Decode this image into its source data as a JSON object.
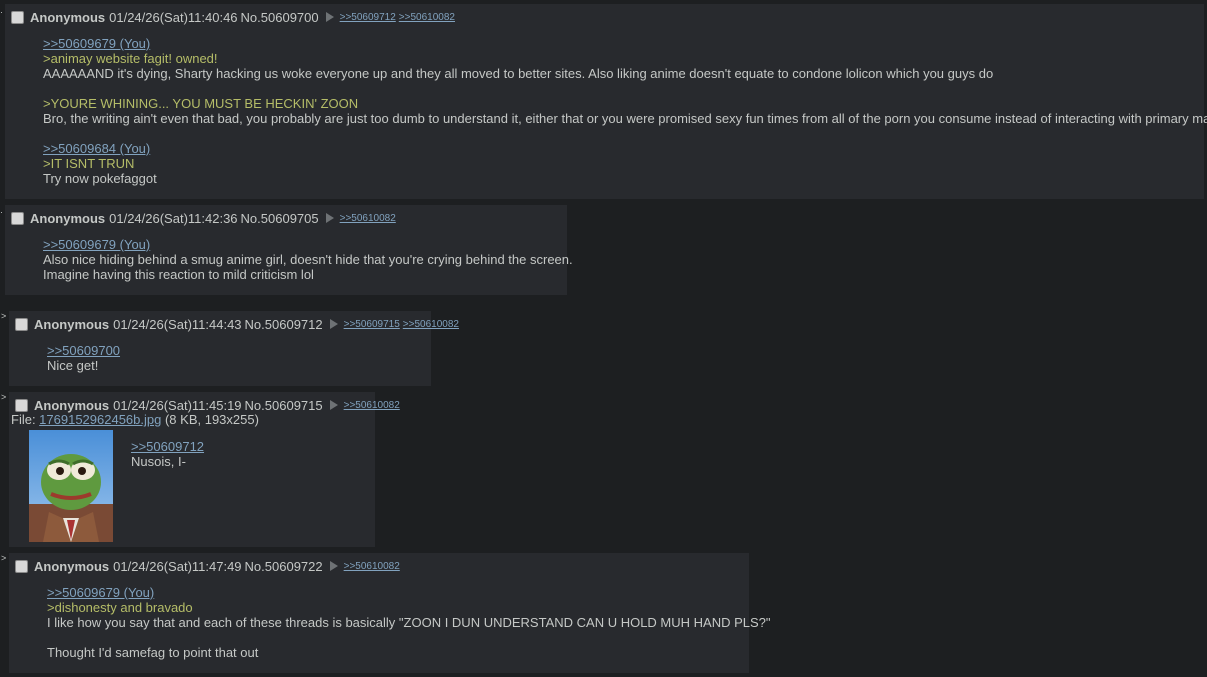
{
  "posts": [
    {
      "name": "Anonymous",
      "datetime": "01/24/26(Sat)11:40:46",
      "number": "No.50609700",
      "backlinks": [
        ">>50609712",
        ">>50610082"
      ],
      "lines": [
        {
          "type": "quote",
          "text": ">>50609679 (You)"
        },
        {
          "type": "green",
          "text": ">animay website fagit! owned!"
        },
        {
          "type": "text",
          "text": "AAAAAAND it's dying, Sharty hacking us woke everyone up and they all moved to better sites. Also liking anime doesn't equate to condone lolicon which you guys do"
        },
        {
          "type": "blank",
          "text": ""
        },
        {
          "type": "green",
          "text": ">YOURE WHINING... YOU MUST BE HECKIN' ZOON"
        },
        {
          "type": "text",
          "text": "Bro, the writing ain't even that bad, you probably are just too dumb to understand it, either that or you were promised sexy fun times from all of the porn you consume instead of interacting with primary materials lol."
        },
        {
          "type": "blank",
          "text": ""
        },
        {
          "type": "quote",
          "text": ">>50609684 (You)"
        },
        {
          "type": "green",
          "text": ">IT ISNT TRUN"
        },
        {
          "type": "text",
          "text": "Try now pokefaggot"
        }
      ]
    },
    {
      "name": "Anonymous",
      "datetime": "01/24/26(Sat)11:42:36",
      "number": "No.50609705",
      "backlinks": [
        ">>50610082"
      ],
      "lines": [
        {
          "type": "quote",
          "text": ">>50609679 (You)"
        },
        {
          "type": "text",
          "text": "Also nice hiding behind a smug anime girl, doesn't hide that you're crying behind the screen."
        },
        {
          "type": "text",
          "text": "Imagine having this reaction to mild criticism lol"
        }
      ]
    },
    {
      "name": "Anonymous",
      "datetime": "01/24/26(Sat)11:44:43",
      "number": "No.50609712",
      "backlinks": [
        ">>50609715",
        ">>50610082"
      ],
      "lines": [
        {
          "type": "quote",
          "text": ">>50609700"
        },
        {
          "type": "text",
          "text": "Nice get!"
        }
      ]
    },
    {
      "name": "Anonymous",
      "datetime": "01/24/26(Sat)11:45:19",
      "number": "No.50609715",
      "backlinks": [
        ">>50610082"
      ],
      "file": {
        "label": "File: ",
        "filename": "1769152962456b.jpg",
        "info": " (8 KB, 193x255)"
      },
      "lines": [
        {
          "type": "quote",
          "text": ">>50609712"
        },
        {
          "type": "text",
          "text": "Nusois, I-"
        }
      ]
    },
    {
      "name": "Anonymous",
      "datetime": "01/24/26(Sat)11:47:49",
      "number": "No.50609722",
      "backlinks": [
        ">>50610082"
      ],
      "lines": [
        {
          "type": "quote",
          "text": ">>50609679 (You)"
        },
        {
          "type": "green",
          "text": ">dishonesty and bravado"
        },
        {
          "type": "text",
          "text": "I like how you say that and each of these threads is basically \"ZOON I DUN UNDERSTAND CAN U HOLD MUH HAND PLS?\""
        },
        {
          "type": "blank",
          "text": ""
        },
        {
          "type": "text",
          "text": "Thought I'd samefag to point that out"
        }
      ]
    }
  ],
  "side_arrow": ">",
  "colors": {
    "background": "#1d1f21",
    "post": "#282a2e",
    "text": "#c5c8c6",
    "link": "#81a2be",
    "greentext": "#b5bd68"
  }
}
